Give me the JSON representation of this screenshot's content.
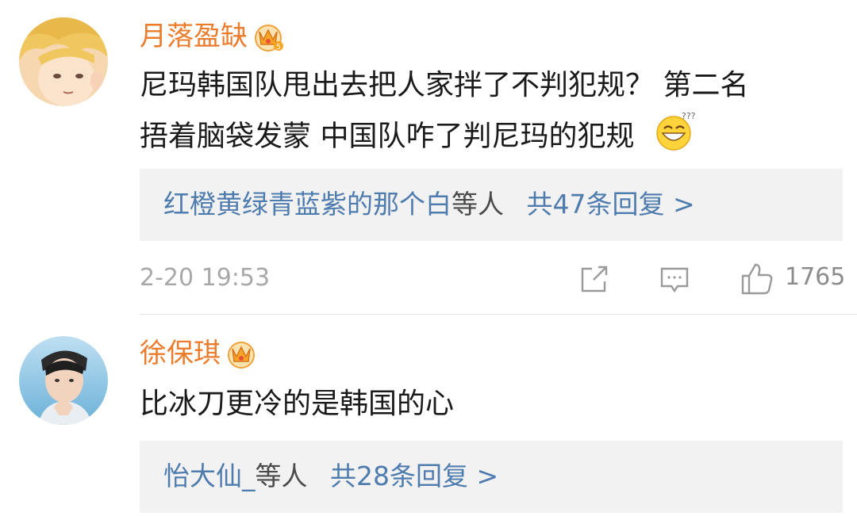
{
  "comments": [
    {
      "username": "月落盈缺",
      "text_line1": "尼玛韩国队甩出去把人家拌了不判犯规？ 第二名",
      "text_line2": "捂着脑袋发蒙 中国队咋了判尼玛的犯规",
      "emoji": "dizzy-grin-emoji",
      "replies_users": "红橙黄绿青蓝紫的那个白",
      "replies_suffix": "等人",
      "replies_count": "共47条回复 >",
      "timestamp": "2-20 19:53",
      "like_count": "1765"
    },
    {
      "username": "徐保琪",
      "text_line1": "比冰刀更冷的是韩国的心",
      "replies_users": "怡大仙_",
      "replies_suffix": "等人",
      "replies_count": "共28条回复 >"
    }
  ],
  "colors": {
    "username": "#eb7c2c",
    "link": "#4f7cae",
    "meta": "#a8a8a8",
    "reply_bg": "#f2f2f2"
  },
  "icons": [
    "crown-icon",
    "share-icon",
    "comment-icon",
    "like-icon"
  ]
}
